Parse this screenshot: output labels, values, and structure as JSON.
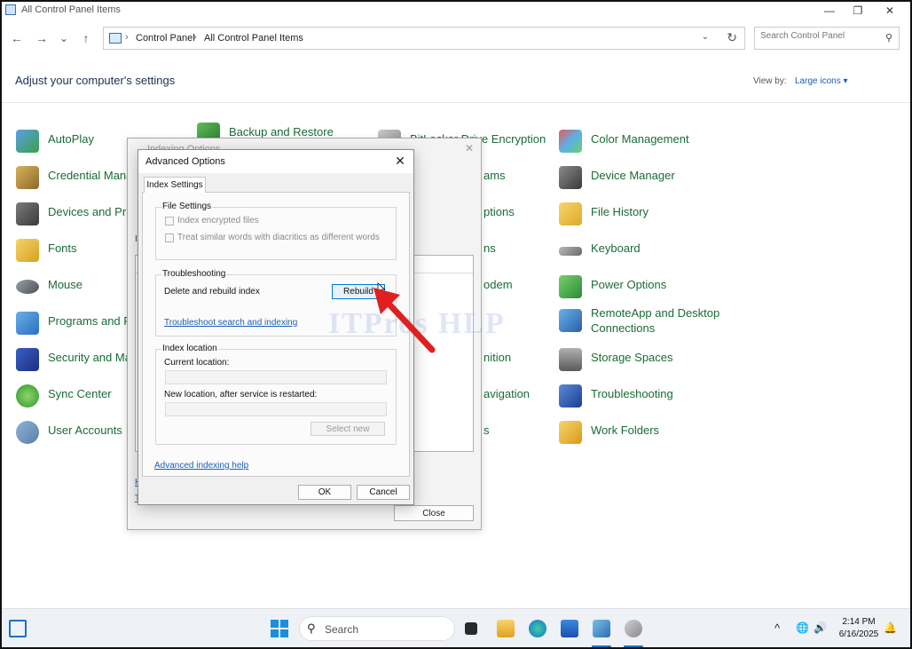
{
  "window": {
    "title": "All Control Panel Items",
    "controls": {
      "minimize": "—",
      "maximize": "❐",
      "close": "✕"
    }
  },
  "nav": {
    "back": "←",
    "forward": "→",
    "recent": "⌄",
    "up": "↑",
    "breadcrumb": [
      "Control Panel",
      "All Control Panel Items"
    ],
    "search_placeholder": "Search Control Panel"
  },
  "header": {
    "title": "Adjust your computer's settings",
    "view_by_label": "View by:",
    "view_by_value": "Large icons ▾"
  },
  "control_panel_items": {
    "col1": [
      "AutoPlay",
      "Credential Mana",
      "Devices and Prin",
      "Fonts",
      "Mouse",
      "Programs and F",
      "Security and Ma",
      "Sync Center",
      "User Accounts"
    ],
    "col2_top": "Backup and Restore",
    "col3_top": "BitLocker Drive Encryption",
    "col3_partial": [
      "ams",
      "ptions",
      "ns",
      "odem",
      "nition",
      "avigation",
      "s"
    ],
    "col4": [
      "Color Management",
      "Device Manager",
      "File History",
      "Keyboard",
      "Power Options",
      "RemoteApp and Desktop",
      "Storage Spaces",
      "Troubleshooting",
      "Work Folders"
    ],
    "col4_remoteapp_line2": "Connections"
  },
  "indexing_dialog": {
    "title": "Indexing Options",
    "stub_letter": "I",
    "link_stub1": "H",
    "link_stub2": "T",
    "close_button": "Close"
  },
  "advanced_dialog": {
    "title": "Advanced Options",
    "tab": "Index Settings",
    "file_settings": {
      "label": "File Settings",
      "option1": "Index encrypted files",
      "option2": "Treat similar words with diacritics as different words"
    },
    "troubleshooting": {
      "label": "Troubleshooting",
      "rebuild_text": "Delete and rebuild index",
      "rebuild_button": "Rebuild",
      "troubleshoot_link": "Troubleshoot search and indexing"
    },
    "index_location": {
      "label": "Index location",
      "current_label": "Current location:",
      "new_label": "New location, after service is restarted:",
      "select_new_button": "Select new"
    },
    "help_link": "Advanced indexing help",
    "ok_button": "OK",
    "cancel_button": "Cancel"
  },
  "watermark": "ITPros HLP",
  "taskbar": {
    "search_label": "Search",
    "clock_time": "2:14 PM",
    "clock_date": "6/16/2025",
    "tray": {
      "chevron": "^",
      "network": "🌐",
      "volume": "🔊",
      "bell": "🔔"
    }
  },
  "colors": {
    "link_green": "#1a6b35",
    "link_blue": "#1a5fb4",
    "accent": "#0078d4",
    "arrow": "#e02020"
  }
}
